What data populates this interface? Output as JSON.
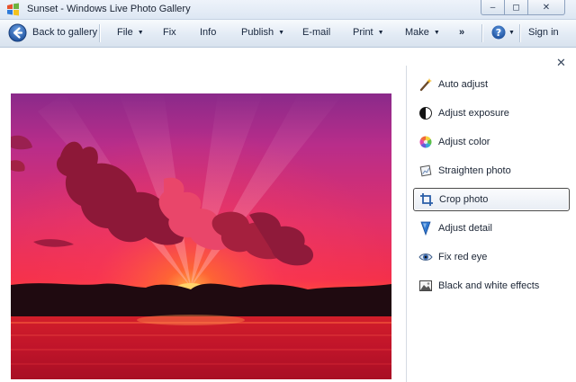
{
  "window": {
    "title": "Sunset - Windows Live Photo Gallery",
    "minimize_glyph": "‒",
    "maximize_glyph": "◻",
    "close_glyph": "✕"
  },
  "toolbar": {
    "back_label": "Back to gallery",
    "file_label": "File",
    "fix_label": "Fix",
    "info_label": "Info",
    "publish_label": "Publish",
    "email_label": "E-mail",
    "print_label": "Print",
    "make_label": "Make",
    "overflow_label": "»",
    "signin_label": "Sign in",
    "caret": "▼",
    "help_caret": "▼"
  },
  "fix_pane": {
    "close_glyph": "✕",
    "items": [
      {
        "label": "Auto adjust",
        "icon": "magic-wand-icon"
      },
      {
        "label": "Adjust exposure",
        "icon": "exposure-icon"
      },
      {
        "label": "Adjust color",
        "icon": "color-wheel-icon"
      },
      {
        "label": "Straighten photo",
        "icon": "straighten-icon"
      },
      {
        "label": "Crop photo",
        "icon": "crop-icon",
        "selected": true
      },
      {
        "label": "Adjust detail",
        "icon": "detail-icon"
      },
      {
        "label": "Fix red eye",
        "icon": "red-eye-icon"
      },
      {
        "label": "Black and white effects",
        "icon": "black-white-icon"
      }
    ]
  },
  "colors": {
    "accent": "#2a5ea8",
    "selected_border": "#4a4a4a"
  }
}
